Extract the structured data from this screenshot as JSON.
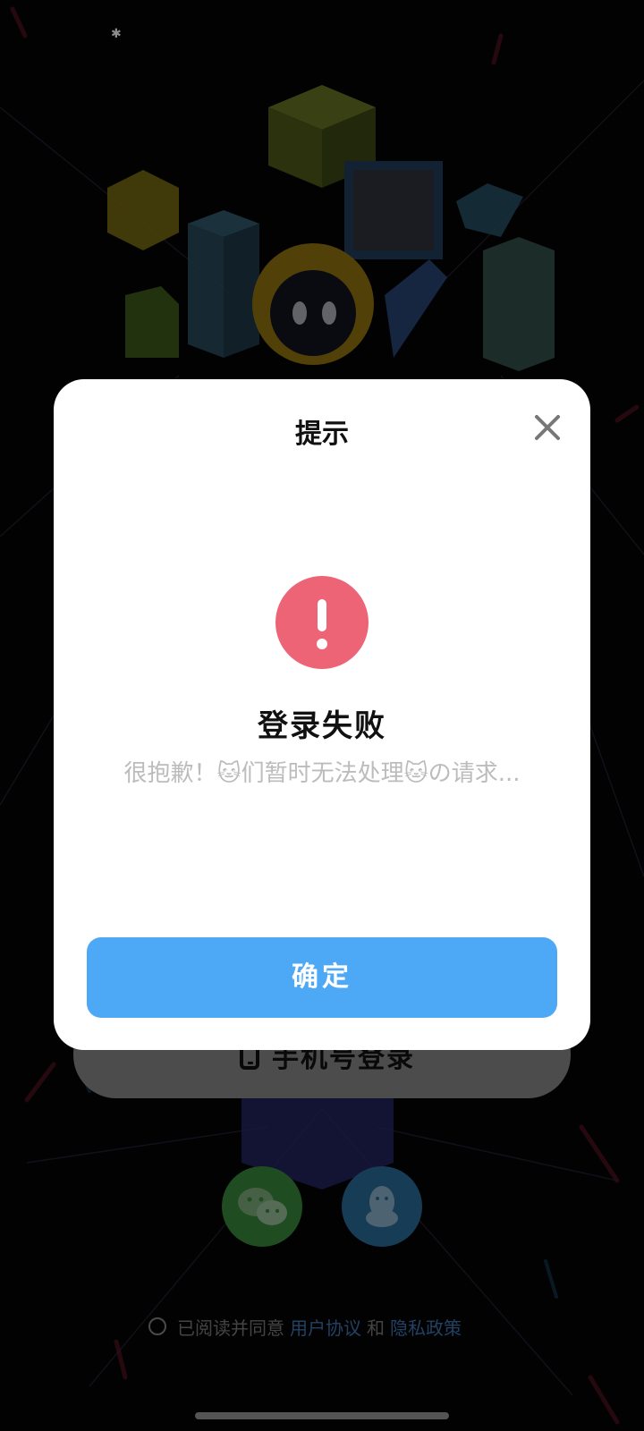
{
  "login_page": {
    "phone_login_label": "手机号登录",
    "agreement": {
      "prefix": "已阅读并同意",
      "user_agreement": "用户协议",
      "and": "和",
      "privacy_policy": "隐私政策"
    }
  },
  "dialog": {
    "title": "提示",
    "heading": "登录失败",
    "message": "很抱歉！🐱们暂时无法处理🐱の请求...",
    "confirm_label": "确定"
  },
  "colors": {
    "confirm_button": "#4da9f5",
    "error_icon": "#ee6477",
    "link": "#3f77b3",
    "wechat": "#3a8a3c",
    "qq": "#2b6e9c"
  }
}
